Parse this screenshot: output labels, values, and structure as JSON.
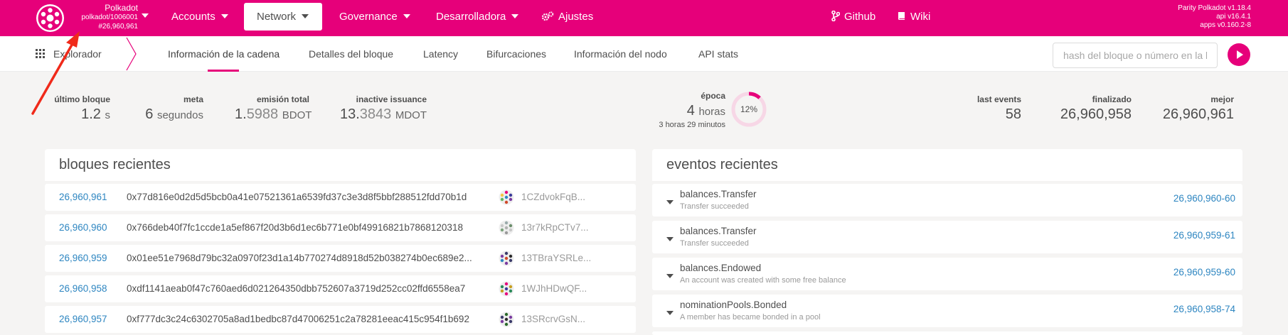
{
  "topbar": {
    "logo_icon": "polkadot-logo-icon",
    "chain_name": "Polkadot",
    "chain_spec": "polkadot/1006001",
    "chain_block": "#26,960,961",
    "menu": [
      {
        "label": "Accounts"
      },
      {
        "label": "Network"
      },
      {
        "label": "Governance"
      },
      {
        "label": "Desarrolladora"
      },
      {
        "label": "Ajustes"
      }
    ],
    "links": [
      {
        "label": "Github",
        "icon": "github-branch-icon"
      },
      {
        "label": "Wiki",
        "icon": "book-icon"
      }
    ],
    "versions": [
      "Parity Polkadot v1.18.4",
      "api v16.4.1",
      "apps v0.160.2-8"
    ],
    "accent": "#e6007a"
  },
  "subnav": {
    "section": "Explorador",
    "tabs": [
      {
        "label": "Información de la cadena"
      },
      {
        "label": "Detalles del bloque"
      },
      {
        "label": "Latency"
      },
      {
        "label": "Bifurcaciones"
      },
      {
        "label": "Información del nodo"
      },
      {
        "label": "API stats"
      }
    ],
    "search_placeholder": "hash del bloque o número en la lista"
  },
  "summary": {
    "last_block": {
      "label": "último bloque",
      "value": "1.2",
      "unit": "s"
    },
    "target": {
      "label": "meta",
      "value": "6",
      "unit": "segundos"
    },
    "total_issuance": {
      "label": "emisión total",
      "int": "1.",
      "frac": "5988",
      "unit": "BDOT"
    },
    "inactive_issuance": {
      "label": "inactive issuance",
      "int": "13.",
      "frac": "3843",
      "unit": "MDOT"
    },
    "epoch": {
      "label": "época",
      "value": "4",
      "unit": "horas",
      "sub_h": "3",
      "sub_h_unit": "horas",
      "sub_m": "29",
      "sub_m_unit": "minutos",
      "progress_label": "12%",
      "progress": 0.12
    },
    "last_events": {
      "label": "last events",
      "value": "58"
    },
    "finalized": {
      "label": "finalizado",
      "value": "26,960,958"
    },
    "best": {
      "label": "mejor",
      "value": "26,960,961"
    }
  },
  "blocks": {
    "title": "bloques recientes",
    "rows": [
      {
        "number": "26,960,961",
        "hash": "0x77d816e0d2d5d5bcb0a41e07521361a6539fd37c3e3d8f5bbf288512fdd70b1d",
        "author": "1CZdvokFqB..."
      },
      {
        "number": "26,960,960",
        "hash": "0x766deb40f7fc1ccde1a5ef867f20d3b6d1ec6b771e0bf49916821b7868120318",
        "author": "13r7kRpCTv7..."
      },
      {
        "number": "26,960,959",
        "hash": "0x01ee51e7968d79bc32a0970f23d1a14b770274d8918d52b038274b0ec689e2...",
        "author": "13TBraYSRLe..."
      },
      {
        "number": "26,960,958",
        "hash": "0xdf1141aeab0f47c760aed6d021264350dbb752607a3719d252cc02ffd6558ea7",
        "author": "1WJhHDwQF..."
      },
      {
        "number": "26,960,957",
        "hash": "0xf777dc3c24c6302705a8ad1bedbc87d47006251c2a78281eeac415c954f1b692",
        "author": "13SRcrvGsN..."
      }
    ]
  },
  "events": {
    "title": "eventos recientes",
    "rows": [
      {
        "name": "balances.Transfer",
        "desc": "Transfer succeeded",
        "ref": "26,960,960-60"
      },
      {
        "name": "balances.Transfer",
        "desc": "Transfer succeeded",
        "ref": "26,960,959-61"
      },
      {
        "name": "balances.Endowed",
        "desc": "An account was created with some free balance",
        "ref": "26,960,959-60"
      },
      {
        "name": "nominationPools.Bonded",
        "desc": "A member has became bonded in a pool",
        "ref": "26,960,958-74"
      }
    ]
  }
}
